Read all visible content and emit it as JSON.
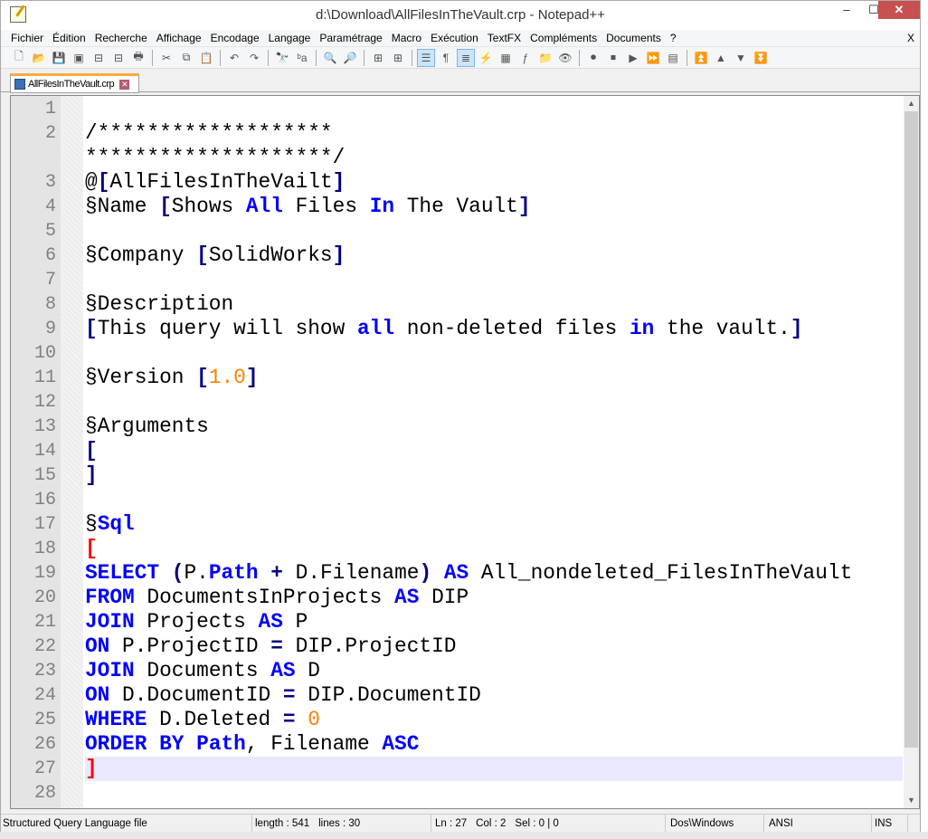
{
  "window": {
    "title": "d:\\Download\\AllFilesInTheVault.crp - Notepad++",
    "min": "–",
    "max": "☐",
    "close": "✕"
  },
  "menu": [
    "Fichier",
    "Édition",
    "Recherche",
    "Affichage",
    "Encodage",
    "Langage",
    "Paramétrage",
    "Macro",
    "Exécution",
    "TextFX",
    "Compléments",
    "Documents",
    "?"
  ],
  "menu_close": "X",
  "toolbar": [
    {
      "icon": "new-file-icon",
      "g": "🗋"
    },
    {
      "icon": "open-file-icon",
      "g": "📂"
    },
    {
      "icon": "save-icon",
      "g": "💾"
    },
    {
      "icon": "save-all-icon",
      "g": "▣"
    },
    {
      "icon": "close-icon",
      "g": "⊟"
    },
    {
      "icon": "close-all-icon",
      "g": "⊟"
    },
    {
      "icon": "print-icon",
      "g": "🖶"
    },
    "|",
    {
      "icon": "cut-icon",
      "g": "✂"
    },
    {
      "icon": "copy-icon",
      "g": "⧉"
    },
    {
      "icon": "paste-icon",
      "g": "📋"
    },
    "|",
    {
      "icon": "undo-icon",
      "g": "↶"
    },
    {
      "icon": "redo-icon",
      "g": "↷"
    },
    "|",
    {
      "icon": "find-icon",
      "g": "🔭"
    },
    {
      "icon": "replace-icon",
      "g": "ᵇa"
    },
    "|",
    {
      "icon": "zoom-in-icon",
      "g": "🔍"
    },
    {
      "icon": "zoom-out-icon",
      "g": "🔎"
    },
    "|",
    {
      "icon": "sync-vertical-icon",
      "g": "⊞"
    },
    {
      "icon": "sync-horizontal-icon",
      "g": "⊞"
    },
    "|",
    {
      "icon": "word-wrap-icon",
      "g": "☰",
      "on": true
    },
    {
      "icon": "show-all-chars-icon",
      "g": "¶"
    },
    {
      "icon": "indent-guide-icon",
      "g": "≣",
      "on": true
    },
    {
      "icon": "udl-icon",
      "g": "⚡"
    },
    {
      "icon": "doc-map-icon",
      "g": "▦"
    },
    {
      "icon": "function-list-icon",
      "g": "ƒ"
    },
    {
      "icon": "folder-icon",
      "g": "📁"
    },
    {
      "icon": "monitor-icon",
      "g": "👁"
    },
    "|",
    {
      "icon": "record-macro-icon",
      "g": "⏺"
    },
    {
      "icon": "stop-macro-icon",
      "g": "⏹"
    },
    {
      "icon": "play-macro-icon",
      "g": "▶"
    },
    {
      "icon": "run-macro-multiple-icon",
      "g": "⏩"
    },
    {
      "icon": "save-macro-icon",
      "g": "▤"
    },
    "|",
    {
      "icon": "go-first-icon",
      "g": "⏫"
    },
    {
      "icon": "go-up-icon",
      "g": "▲"
    },
    {
      "icon": "go-down-icon",
      "g": "▼"
    },
    {
      "icon": "go-last-icon",
      "g": "⏬"
    }
  ],
  "tab": {
    "label": "AllFilesInTheVault.crp",
    "close": "✕"
  },
  "editor": {
    "current_line": 27,
    "lines": [
      {
        "n": "1",
        "t": []
      },
      {
        "n": "2",
        "t": [
          [
            "/*******************",
            ""
          ]
        ]
      },
      {
        "n": "",
        "t": [
          [
            "********************/",
            ""
          ]
        ]
      },
      {
        "n": "3",
        "t": [
          [
            "@",
            ""
          ],
          [
            "[",
            "op"
          ],
          [
            "AllFilesInTheVailt",
            ""
          ],
          [
            "]",
            "op"
          ]
        ]
      },
      {
        "n": "4",
        "t": [
          [
            "§Name ",
            ""
          ],
          [
            "[",
            "op"
          ],
          [
            "Shows ",
            ""
          ],
          [
            "All",
            "kw"
          ],
          [
            " Files ",
            ""
          ],
          [
            "In",
            "kw"
          ],
          [
            " The Vault",
            ""
          ],
          [
            "]",
            "op"
          ]
        ]
      },
      {
        "n": "5",
        "t": []
      },
      {
        "n": "6",
        "t": [
          [
            "§Company ",
            ""
          ],
          [
            "[",
            "op"
          ],
          [
            "SolidWorks",
            ""
          ],
          [
            "]",
            "op"
          ]
        ]
      },
      {
        "n": "7",
        "t": []
      },
      {
        "n": "8",
        "t": [
          [
            "§Description",
            ""
          ]
        ]
      },
      {
        "n": "9",
        "t": [
          [
            "[",
            "op"
          ],
          [
            "This query will show ",
            ""
          ],
          [
            "all",
            "kw"
          ],
          [
            " non-deleted files ",
            ""
          ],
          [
            "in",
            "kw"
          ],
          [
            " the vault.",
            ""
          ],
          [
            "]",
            "op"
          ]
        ]
      },
      {
        "n": "10",
        "t": []
      },
      {
        "n": "11",
        "t": [
          [
            "§Version ",
            ""
          ],
          [
            "[",
            "op"
          ],
          [
            "1.0",
            "num"
          ],
          [
            "]",
            "op"
          ]
        ]
      },
      {
        "n": "12",
        "t": []
      },
      {
        "n": "13",
        "t": [
          [
            "§Arguments",
            ""
          ]
        ]
      },
      {
        "n": "14",
        "t": [
          [
            "[",
            "op"
          ]
        ]
      },
      {
        "n": "15",
        "t": [
          [
            "]",
            "op"
          ]
        ]
      },
      {
        "n": "16",
        "t": []
      },
      {
        "n": "17",
        "t": [
          [
            "§",
            ""
          ],
          [
            "Sql",
            "kw"
          ]
        ]
      },
      {
        "n": "18",
        "t": [
          [
            "[",
            "red"
          ]
        ]
      },
      {
        "n": "19",
        "t": [
          [
            "SELECT",
            "kw"
          ],
          [
            " ",
            ""
          ],
          [
            "(",
            "op"
          ],
          [
            "P.",
            ""
          ],
          [
            "Path",
            "kw"
          ],
          [
            " ",
            ""
          ],
          [
            "+",
            "op"
          ],
          [
            " D.Filename",
            ""
          ],
          [
            ")",
            "op"
          ],
          [
            " ",
            ""
          ],
          [
            "AS",
            "kw"
          ],
          [
            " All_nondeleted_FilesInTheVault",
            ""
          ]
        ]
      },
      {
        "n": "20",
        "t": [
          [
            "FROM",
            "kw"
          ],
          [
            " DocumentsInProjects ",
            ""
          ],
          [
            "AS",
            "kw"
          ],
          [
            " DIP",
            ""
          ]
        ]
      },
      {
        "n": "21",
        "t": [
          [
            "JOIN",
            "kw"
          ],
          [
            " Projects ",
            ""
          ],
          [
            "AS",
            "kw"
          ],
          [
            " P",
            ""
          ]
        ]
      },
      {
        "n": "22",
        "t": [
          [
            "ON",
            "kw"
          ],
          [
            " P.ProjectID ",
            ""
          ],
          [
            "=",
            "op"
          ],
          [
            " DIP.ProjectID",
            ""
          ]
        ]
      },
      {
        "n": "23",
        "t": [
          [
            "JOIN",
            "kw"
          ],
          [
            " Documents ",
            ""
          ],
          [
            "AS",
            "kw"
          ],
          [
            " D",
            ""
          ]
        ]
      },
      {
        "n": "24",
        "t": [
          [
            "ON",
            "kw"
          ],
          [
            " D.DocumentID ",
            ""
          ],
          [
            "=",
            "op"
          ],
          [
            " DIP.DocumentID",
            ""
          ]
        ]
      },
      {
        "n": "25",
        "t": [
          [
            "WHERE",
            "kw"
          ],
          [
            " D.Deleted ",
            ""
          ],
          [
            "=",
            "op"
          ],
          [
            " ",
            ""
          ],
          [
            "0",
            "num"
          ]
        ]
      },
      {
        "n": "26",
        "t": [
          [
            "ORDER BY",
            "kw"
          ],
          [
            " ",
            ""
          ],
          [
            "Path",
            "kw"
          ],
          [
            ", Filename ",
            ""
          ],
          [
            "ASC",
            "kw"
          ]
        ]
      },
      {
        "n": "27",
        "t": [
          [
            "]",
            "red"
          ]
        ]
      },
      {
        "n": "28",
        "t": []
      }
    ]
  },
  "status": {
    "type": "Structured Query Language file",
    "length": "length : 541",
    "lines": "lines : 30",
    "ln": "Ln : 27",
    "col": "Col : 2",
    "sel": "Sel : 0 | 0",
    "eol": "Dos\\Windows",
    "enc": "ANSI",
    "mode": "INS"
  },
  "colors": {
    "keyword": "#0000ff",
    "operator": "#000080",
    "number": "#ff8000",
    "bracket_sql": "#ff0000",
    "current_line": "#e8e8ff",
    "tab_accent": "#fbab3d"
  }
}
